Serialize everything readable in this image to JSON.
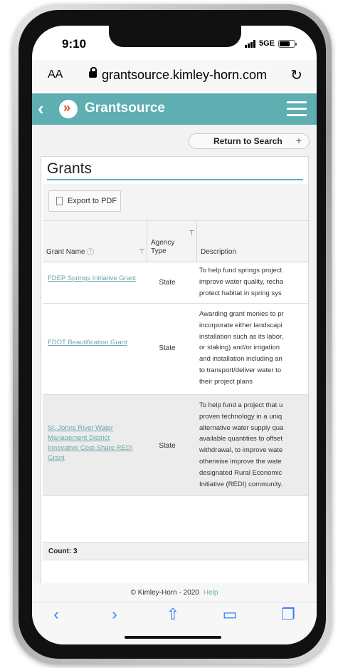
{
  "status_bar": {
    "time": "9:10",
    "network": "5GE"
  },
  "browser": {
    "text_size": "AA",
    "url": "grantsource.kimley-horn.com",
    "reload_icon": "reload-icon"
  },
  "app_bar": {
    "brand": "Grantsource",
    "back_icon": "chevron-left-icon",
    "menu_icon": "hamburger-icon",
    "color": "#5eaeb2"
  },
  "toolbar": {
    "return_to_search": "Return to Search",
    "plus": "+",
    "export_pdf": "Export to PDF"
  },
  "grants_panel": {
    "title": "Grants"
  },
  "table": {
    "columns": {
      "grant_name": "Grant Name",
      "agency_type": "Agency Type",
      "description": "Description"
    },
    "rows": [
      {
        "grant_name": "FDEP Springs Initiative Grant",
        "agency_type": "State",
        "description": [
          "To help fund springs project",
          "improve water quality, recha",
          "protect habitat in spring sys"
        ]
      },
      {
        "grant_name": "FDOT Beautification Grant",
        "agency_type": "State",
        "description": [
          "Awarding grant monies to pr",
          "incorporate either landscapi",
          "installation such as its labor,",
          "or staking) and/or irrigation",
          "and installation including an",
          "to transport/deliver water to",
          "their project plans"
        ]
      },
      {
        "grant_name": "St. Johns River Water Management District Innovative Cost-Share REDI Grant",
        "agency_type": "State",
        "description": [
          "To help fund a project that u",
          "proven technology in a uniq",
          "alternative water supply qua",
          "available quantities to offset",
          "withdrawal, to improve wate",
          "otherwise improve the wate",
          "designated Rural Economic",
          "Initiative (REDI) community."
        ]
      }
    ],
    "count_label": "Count: 3"
  },
  "footer": {
    "copyright": "© Kimley-Horn - 2020",
    "help_link": "Help"
  },
  "safari_bar": {
    "icons": [
      "back-icon",
      "forward-icon",
      "share-icon",
      "bookmarks-icon",
      "tabs-icon"
    ]
  }
}
